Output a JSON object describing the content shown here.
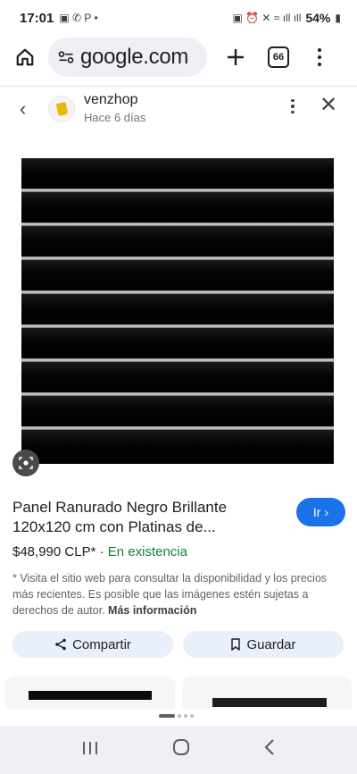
{
  "status_bar": {
    "time": "17:01",
    "battery": "54%"
  },
  "browser": {
    "url": "google.com",
    "tab_count": "66"
  },
  "merchant": {
    "name": "venzhop",
    "time_ago": "Hace 6 días"
  },
  "product": {
    "title": "Panel Ranurado Negro Brillante 120x120 cm con Platinas de...",
    "price": "$48,990 CLP*",
    "separator": "·",
    "stock": "En existencia",
    "go_button": "Ir",
    "notice": "* Visita el sitio web para consultar la disponibilidad y los precios más recientes. Es posible que las imágenes estén sujetas a derechos de autor.",
    "more_info": "Más información"
  },
  "actions": {
    "share": "Compartir",
    "save": "Guardar"
  },
  "colors": {
    "accent": "#1a73e8",
    "stock_green": "#188038",
    "chip_bg": "#e9effb"
  }
}
